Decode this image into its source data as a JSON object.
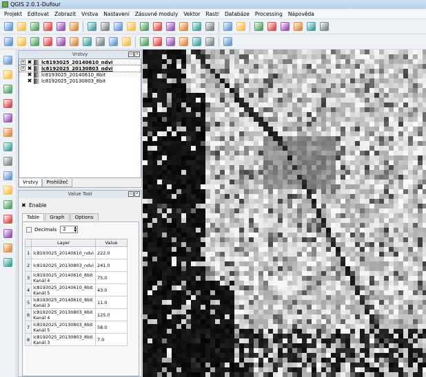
{
  "window": {
    "title": "QGIS 2.0.1-Dufour"
  },
  "menu": [
    "Projekt",
    "Editovat",
    "Zobrazit",
    "Vrstva",
    "Nastavení",
    "Zásuvné moduly",
    "Vektor",
    "Rastr",
    "Databáze",
    "Processing",
    "Nápověda"
  ],
  "layers_panel": {
    "title": "Vrstvy",
    "layers": [
      {
        "name": "lc8193025_20140610_ndvi",
        "expanded": "+",
        "checked": true,
        "selected": false,
        "bold": true
      },
      {
        "name": "lc8192025_20130803_ndvi",
        "expanded": "+",
        "checked": true,
        "selected": true,
        "bold": true
      },
      {
        "name": "lc8193025_20140610_8bit",
        "expanded": "",
        "checked": true,
        "selected": false,
        "bold": false
      },
      {
        "name": "lc8192025_20130803_8bit",
        "expanded": "",
        "checked": true,
        "selected": false,
        "bold": false
      }
    ],
    "tabs": [
      "Vrstvy",
      "Prohlížeč"
    ]
  },
  "value_tool": {
    "title": "Value Tool",
    "enable_label": "Enable",
    "tabs": [
      "Table",
      "Graph",
      "Options"
    ],
    "decimals_label": "Decimals",
    "decimals_value": "2",
    "columns": [
      "Layer",
      "Value"
    ],
    "rows": [
      {
        "n": "1",
        "layer": "lc8193025_20140610_ndvi",
        "value": "222.0"
      },
      {
        "n": "2",
        "layer": "lc8192025_20130803_ndvi",
        "value": "241.0"
      },
      {
        "n": "3",
        "layer": "lc8193025_20140610_8bit\nKanál 4",
        "value": "75.0"
      },
      {
        "n": "4",
        "layer": "lc8193025_20140610_8bit\nKanál 5",
        "value": "43.0"
      },
      {
        "n": "5",
        "layer": "lc8193025_20140610_8bit\nKanál 3",
        "value": "11.0"
      },
      {
        "n": "6",
        "layer": "lc8192025_20130803_8bit\nKanál 4",
        "value": "125.0"
      },
      {
        "n": "7",
        "layer": "lc8192025_20130803_8bit\nKanál 5",
        "value": "58.0"
      },
      {
        "n": "8",
        "layer": "lc8192025_20130803_8bit\nKanál 3",
        "value": "7.0"
      }
    ]
  },
  "toolbar_icons": [
    "new-project-icon",
    "open-icon",
    "save-icon",
    "save-as-icon",
    "new-print-composer-icon",
    "composer-manager-icon",
    "pan-icon",
    "pan-to-selection-icon",
    "zoom-in-icon",
    "zoom-out-icon",
    "zoom-full-icon",
    "zoom-to-selection-icon",
    "zoom-to-layer-icon",
    "zoom-last-icon",
    "zoom-next-icon",
    "refresh-icon",
    "identify-icon",
    "measure-icon",
    "select-icon",
    "deselect-icon",
    "field-calculator-icon",
    "attribute-table-icon",
    "map-tips-icon",
    "annotation-icon"
  ],
  "digitizing_icons": [
    "current-edits-icon",
    "toggle-editing-icon",
    "save-edits-icon",
    "add-feature-icon",
    "move-feature-icon",
    "node-tool-icon",
    "delete-selected-icon",
    "cut-features-icon",
    "copy-features-icon",
    "paste-features-icon",
    "label-icon",
    "pin-labels-icon",
    "show-hide-labels-icon",
    "move-label-icon",
    "rotate-label-icon",
    "change-label-icon",
    "value-tool-icon"
  ],
  "left_icons": [
    "add-vector-layer-icon",
    "add-raster-layer-icon",
    "add-postgis-layer-icon",
    "add-spatialite-layer-icon",
    "add-mssql-layer-icon",
    "add-oracle-layer-icon",
    "add-wms-layer-icon",
    "add-wcs-layer-icon",
    "add-wfs-layer-icon",
    "add-delimited-text-icon",
    "new-shapefile-icon",
    "new-spatialite-icon",
    "gps-icon",
    "georeferencer-icon",
    "vector-tools-icon"
  ],
  "colors": {
    "titlebar": "#c9dcf1",
    "panel_bg": "#f0f0f0",
    "selection_outline": "#666666"
  }
}
